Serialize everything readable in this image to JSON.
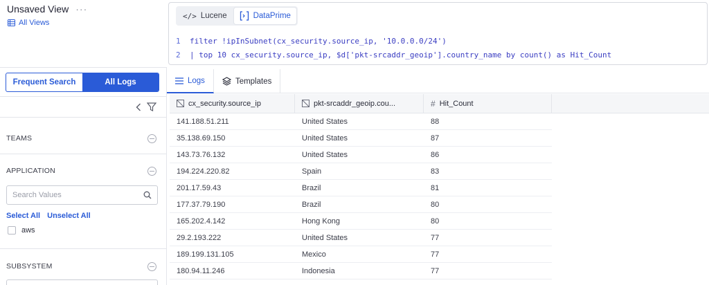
{
  "view": {
    "title": "Unsaved View",
    "more": "···",
    "all_views": "All Views"
  },
  "editor": {
    "lang_lucene": "Lucene",
    "lang_dataprime": "DataPrime",
    "lines": [
      {
        "n": "1",
        "text": "filter !ipInSubnet(cx_security.source_ip, '10.0.0.0/24')"
      },
      {
        "n": "2",
        "text": "| top 10 cx_security.source_ip, $d['pkt-srcaddr_geoip'].country_name by count() as Hit_Count"
      }
    ]
  },
  "sidebar": {
    "seg_frequent": "Frequent Search",
    "seg_all_logs": "All Logs",
    "teams": "TEAMS",
    "application": "APPLICATION",
    "search_placeholder": "Search Values",
    "select_all": "Select All",
    "unselect_all": "Unselect All",
    "app_value": "aws",
    "subsystem": "SUBSYSTEM"
  },
  "tabs": {
    "logs": "Logs",
    "templates": "Templates"
  },
  "table": {
    "headers": [
      "cx_security.source_ip",
      "pkt-srcaddr_geoip.cou...",
      "Hit_Count"
    ],
    "rows": [
      [
        "141.188.51.211",
        "United States",
        "88"
      ],
      [
        "35.138.69.150",
        "United States",
        "87"
      ],
      [
        "143.73.76.132",
        "United States",
        "86"
      ],
      [
        "194.224.220.82",
        "Spain",
        "83"
      ],
      [
        "201.17.59.43",
        "Brazil",
        "81"
      ],
      [
        "177.37.79.190",
        "Brazil",
        "80"
      ],
      [
        "165.202.4.142",
        "Hong Kong",
        "80"
      ],
      [
        "29.2.193.222",
        "United States",
        "77"
      ],
      [
        "189.199.131.105",
        "Mexico",
        "77"
      ],
      [
        "180.94.11.246",
        "Indonesia",
        "77"
      ]
    ]
  },
  "colors": {
    "accent": "#2a5bd7",
    "border": "#e3e5ea",
    "header_bg": "#f5f6f8"
  }
}
